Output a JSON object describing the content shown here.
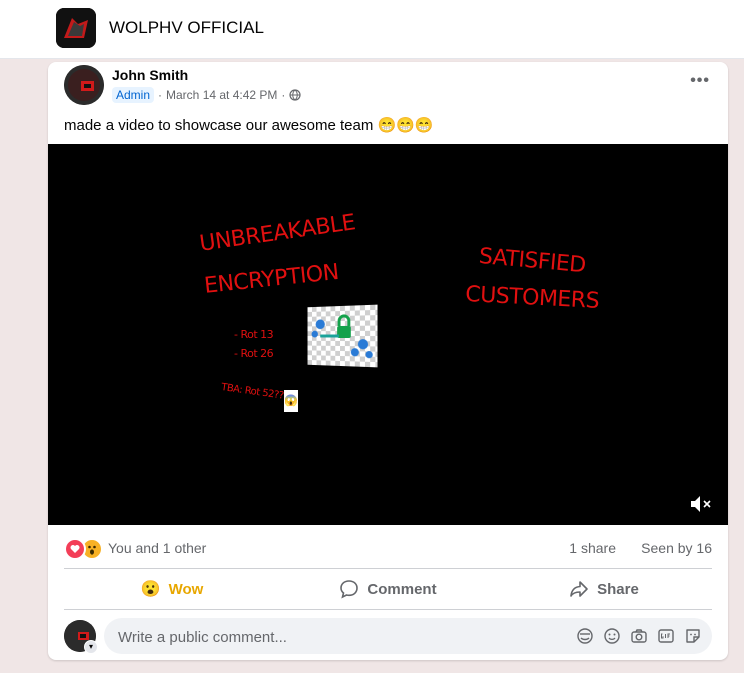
{
  "group": {
    "name": "WOLPHV OFFICIAL"
  },
  "post": {
    "author": "John Smith",
    "badge": "Admin",
    "timestamp": "March 14 at 4:42 PM",
    "separator": "·",
    "more": "•••",
    "text": "made a video to showcase our awesome team 😁😁😁"
  },
  "video": {
    "lines": [
      "UNBREAKABLE",
      "ENCRYPTION",
      "SATISFIED",
      "CUSTOMERS",
      "- Rot 13",
      "- Rot 26",
      "TBA: Rot 52???"
    ],
    "emoji": "😱",
    "muted": true
  },
  "stats": {
    "reactions_label": "You and 1 other",
    "shares": "1 share",
    "seen": "Seen by 16",
    "reaction_icons": [
      "love-icon",
      "wow-icon"
    ]
  },
  "actions": {
    "wow": "Wow",
    "wow_emoji": "😮",
    "comment": "Comment",
    "share": "Share"
  },
  "comment": {
    "placeholder": "Write a public comment...",
    "tools": [
      "avatar-sticker-icon",
      "emoji-icon",
      "camera-icon",
      "gif-icon",
      "sticker-icon"
    ]
  },
  "colors": {
    "page_bg": "#f0e6e6",
    "accent_text": "#e01010",
    "wow": "#e8a700",
    "love": "#f33e58",
    "admin_badge": "#e7f3ff"
  }
}
